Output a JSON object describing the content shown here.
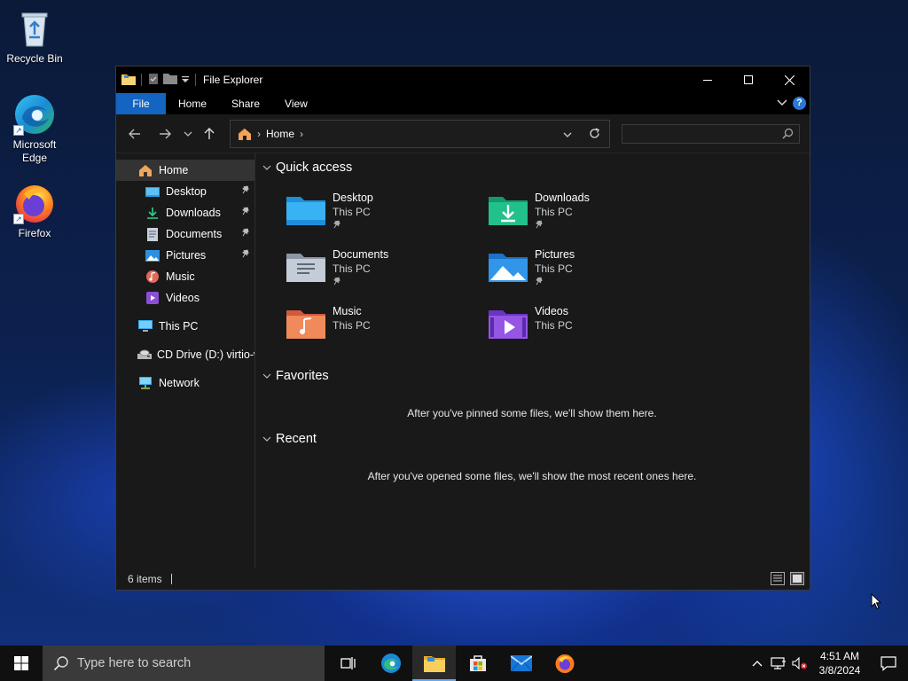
{
  "desktop": {
    "icons": [
      {
        "label": "Recycle Bin"
      },
      {
        "label": "Microsoft Edge"
      },
      {
        "label": "Firefox"
      }
    ]
  },
  "window": {
    "title": "File Explorer",
    "ribbon_tabs": [
      "File",
      "Home",
      "Share",
      "View"
    ],
    "address": {
      "crumb": "Home"
    },
    "search": {
      "value": "",
      "placeholder": ""
    }
  },
  "sidebar": {
    "items": [
      {
        "label": "Home",
        "icon": "home-icon",
        "selected": true
      },
      {
        "label": "Desktop",
        "icon": "desktop-folder-icon",
        "pinned": true
      },
      {
        "label": "Downloads",
        "icon": "download-icon",
        "pinned": true
      },
      {
        "label": "Documents",
        "icon": "documents-icon",
        "pinned": true
      },
      {
        "label": "Pictures",
        "icon": "pictures-icon",
        "pinned": true
      },
      {
        "label": "Music",
        "icon": "music-icon"
      },
      {
        "label": "Videos",
        "icon": "videos-icon"
      },
      {
        "label": "This PC",
        "icon": "computer-icon"
      },
      {
        "label": "CD Drive (D:) virtio-w",
        "icon": "cd-drive-icon"
      },
      {
        "label": "Network",
        "icon": "network-icon"
      }
    ]
  },
  "content": {
    "quick_access": {
      "title": "Quick access",
      "items": [
        {
          "name": "Desktop",
          "location": "This PC",
          "pinned": true
        },
        {
          "name": "Downloads",
          "location": "This PC",
          "pinned": true
        },
        {
          "name": "Documents",
          "location": "This PC",
          "pinned": true
        },
        {
          "name": "Pictures",
          "location": "This PC",
          "pinned": true
        },
        {
          "name": "Music",
          "location": "This PC",
          "pinned": false
        },
        {
          "name": "Videos",
          "location": "This PC",
          "pinned": false
        }
      ]
    },
    "favorites": {
      "title": "Favorites",
      "empty_message": "After you've pinned some files, we'll show them here."
    },
    "recent": {
      "title": "Recent",
      "empty_message": "After you've opened some files, we'll show the most recent ones here."
    }
  },
  "statusbar": {
    "count": "6 items"
  },
  "taskbar": {
    "search_placeholder": "Type here to search",
    "time": "4:51 AM",
    "date": "3/8/2024"
  },
  "colors": {
    "accent": "#1464c2",
    "window_bg": "#191919",
    "titlebar_bg": "#000000",
    "taskbar_bg": "#101010",
    "selected_item_bg": "#333333"
  }
}
